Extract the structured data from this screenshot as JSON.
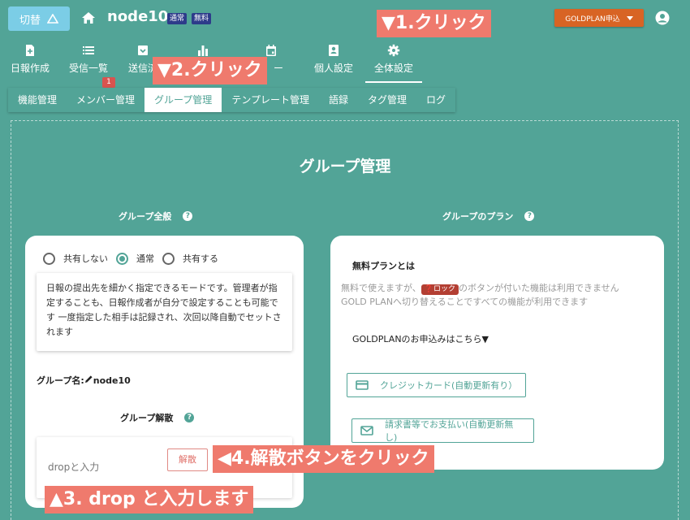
{
  "topbar": {
    "switch_label": "切替",
    "node_title": "node10",
    "badges": [
      "通常",
      "無料"
    ],
    "gold_button": "GOLDPLAN申込"
  },
  "nav": {
    "items": [
      {
        "label": "日報作成",
        "icon": "file-add-icon"
      },
      {
        "label": "受信一覧",
        "icon": "list-icon"
      },
      {
        "label": "送信済",
        "icon": "archive-icon"
      },
      {
        "label": "",
        "icon": "bar-chart-icon"
      },
      {
        "label": "ー",
        "icon": "calendar-icon"
      },
      {
        "label": "個人設定",
        "icon": "id-card-icon"
      },
      {
        "label": "全体設定",
        "icon": "gear-icon"
      }
    ],
    "notification_count": "1"
  },
  "subtabs": [
    "機能管理",
    "メンバー管理",
    "グループ管理",
    "テンプレート管理",
    "語録",
    "タグ管理",
    "ログ"
  ],
  "main": {
    "page_title": "グループ管理",
    "group_general": {
      "heading": "グループ全般",
      "options": [
        "共有しない",
        "通常",
        "共有する"
      ],
      "selected": "通常",
      "description": "日報の提出先を細かく指定できるモードです。管理者が指定することも、日報作成者が自分で設定することも可能です 一度指定した相手は記録され、次回以降自動でセットされます",
      "group_name_label": "グループ名:",
      "group_name": "node10",
      "dissolve_heading": "グループ解散",
      "drop_placeholder": "dropと入力",
      "dissolve_button": "解散"
    },
    "plan": {
      "heading": "グループのプラン",
      "free_plan_title": "無料プランとは",
      "line1_pre": "無料で使えますが、",
      "lock_badge": "ロック",
      "line1_post": "のボタンが付いた機能は利用できません",
      "line2": "GOLD PLANへ切り替えることですべての機能が利用できます",
      "apply_text": "GOLDPLANのお申込みはこちら▼",
      "credit_button": "クレジットカード(自動更新有り）",
      "invoice_button": "請求書等でお支払い(自動更新無し)"
    }
  },
  "annotations": {
    "a1": "▼1.クリック",
    "a2": "▼2.クリック",
    "a3": "▲3. drop と入力します",
    "a4": "◀4.解散ボタンをクリック"
  },
  "colors": {
    "background": "#52a497",
    "annotation": "#ef7a6d",
    "gold_button": "#d86424",
    "switch_button": "#7bcde6",
    "badge": "#2d3b8a"
  }
}
